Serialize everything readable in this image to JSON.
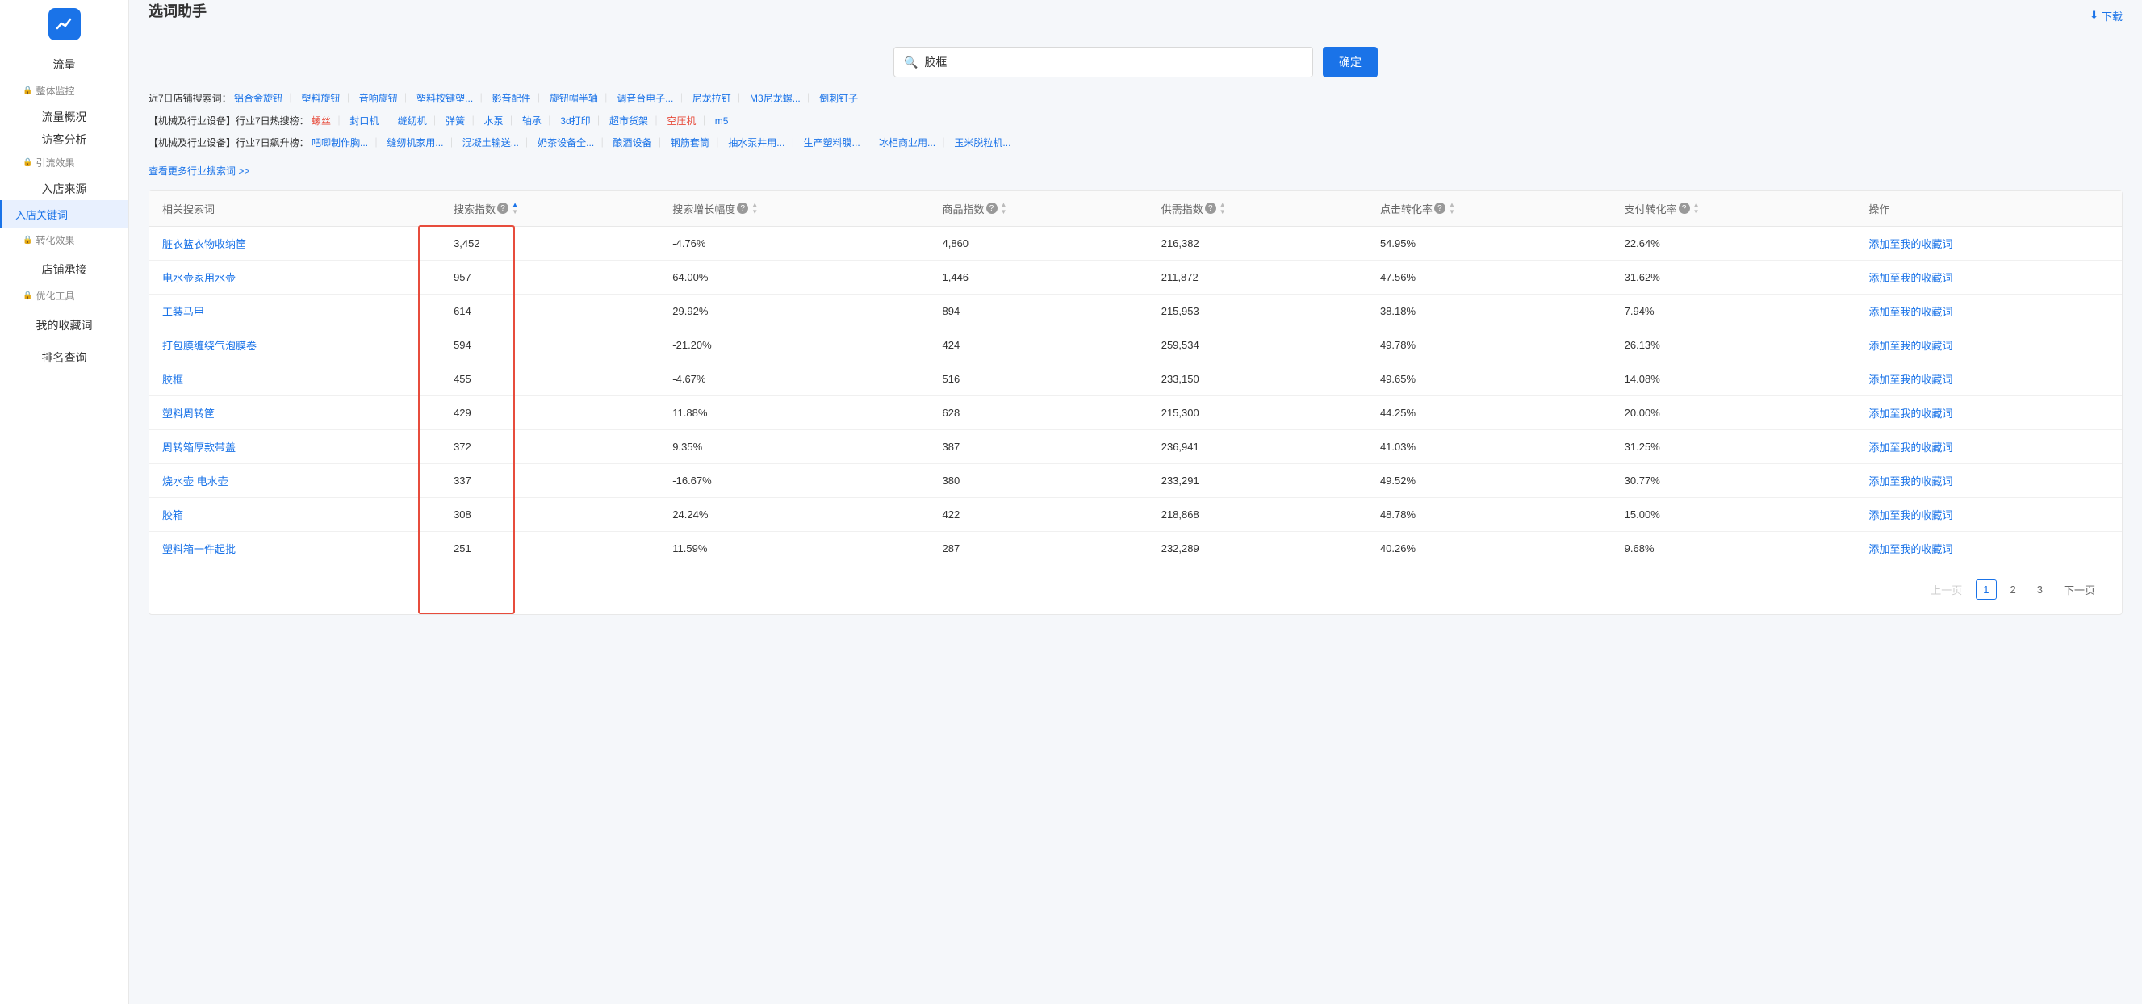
{
  "sidebar": {
    "logo_alt": "chart-icon",
    "sections": [
      {
        "title": "流量",
        "items": [
          {
            "label": "整体监控",
            "has_lock": true,
            "active": false,
            "id": "overall-monitor"
          },
          {
            "label": "流量概况",
            "has_lock": false,
            "active": false,
            "id": "traffic-overview"
          },
          {
            "label": "访客分析",
            "has_lock": false,
            "active": false,
            "id": "visitor-analysis"
          },
          {
            "label": "引流效果",
            "has_lock": true,
            "active": false,
            "id": "traffic-effect"
          },
          {
            "label": "入店来源",
            "has_lock": false,
            "active": false,
            "id": "store-source"
          },
          {
            "label": "入店关键词",
            "has_lock": false,
            "active": true,
            "id": "store-keywords"
          },
          {
            "label": "转化效果",
            "has_lock": true,
            "active": false,
            "id": "conversion-effect"
          }
        ]
      },
      {
        "title": "店铺承接",
        "items": []
      },
      {
        "title": "优化工具",
        "items": [],
        "has_lock": true
      },
      {
        "title": "我的收藏词",
        "items": []
      },
      {
        "title": "排名查询",
        "items": []
      }
    ]
  },
  "header": {
    "title": "选词助手",
    "download_label": "下载"
  },
  "search": {
    "placeholder": "胶框",
    "value": "胶框",
    "confirm_label": "确定"
  },
  "hot_search": {
    "label_7day": "近7日店铺搜索词：",
    "items_7day": [
      "铝合金旋钮",
      "塑料旋钮",
      "音响旋钮",
      "塑料按键塑...",
      "影音配件",
      "旋钮帽半轴",
      "调音台电子...",
      "尼龙拉钉",
      "M3尼龙螺...",
      "倒刺钉子"
    ],
    "label_industry_hot": "【机械及行业设备】行业7日热搜榜：",
    "items_industry_hot": [
      "螺丝",
      "封口机",
      "缝纫机",
      "弹簧",
      "水泵",
      "轴承",
      "3d打印",
      "超市货架",
      "空压机",
      "m5"
    ],
    "label_industry_up": "【机械及行业设备】行业7日飙升榜：",
    "items_industry_up": [
      "吧唧制作胸...",
      "缝纫机家用...",
      "混凝土输送...",
      "奶茶设备全...",
      "酿酒设备",
      "钢筋套筒",
      "抽水泵井用...",
      "生产塑料膜...",
      "冰柜商业用...",
      "玉米脱粒机..."
    ]
  },
  "more_link": "查看更多行业搜索词 >>",
  "table": {
    "columns": [
      {
        "id": "keyword",
        "label": "相关搜索词",
        "sortable": false,
        "info": false
      },
      {
        "id": "search_index",
        "label": "搜索指数",
        "sortable": true,
        "info": true,
        "active_sort": true
      },
      {
        "id": "search_growth",
        "label": "搜索增长幅度",
        "sortable": true,
        "info": true
      },
      {
        "id": "product_index",
        "label": "商品指数",
        "sortable": true,
        "info": true
      },
      {
        "id": "supply_index",
        "label": "供需指数",
        "sortable": true,
        "info": true
      },
      {
        "id": "click_conversion",
        "label": "点击转化率",
        "sortable": true,
        "info": true
      },
      {
        "id": "pay_conversion",
        "label": "支付转化率",
        "sortable": true,
        "info": true
      },
      {
        "id": "action",
        "label": "操作",
        "sortable": false,
        "info": false
      }
    ],
    "rows": [
      {
        "keyword": "脏衣篮衣物收纳筐",
        "search_index": "3,452",
        "search_growth": "-4.76%",
        "product_index": "4,860",
        "supply_index": "216,382",
        "click_conversion": "54.95%",
        "pay_conversion": "22.64%",
        "action": "添加至我的收藏词"
      },
      {
        "keyword": "电水壶家用水壶",
        "search_index": "957",
        "search_growth": "64.00%",
        "product_index": "1,446",
        "supply_index": "211,872",
        "click_conversion": "47.56%",
        "pay_conversion": "31.62%",
        "action": "添加至我的收藏词"
      },
      {
        "keyword": "工装马甲",
        "search_index": "614",
        "search_growth": "29.92%",
        "product_index": "894",
        "supply_index": "215,953",
        "click_conversion": "38.18%",
        "pay_conversion": "7.94%",
        "action": "添加至我的收藏词"
      },
      {
        "keyword": "打包膜缠绕气泡膜卷",
        "search_index": "594",
        "search_growth": "-21.20%",
        "product_index": "424",
        "supply_index": "259,534",
        "click_conversion": "49.78%",
        "pay_conversion": "26.13%",
        "action": "添加至我的收藏词"
      },
      {
        "keyword": "胶框",
        "search_index": "455",
        "search_growth": "-4.67%",
        "product_index": "516",
        "supply_index": "233,150",
        "click_conversion": "49.65%",
        "pay_conversion": "14.08%",
        "action": "添加至我的收藏词"
      },
      {
        "keyword": "塑料周转筐",
        "search_index": "429",
        "search_growth": "11.88%",
        "product_index": "628",
        "supply_index": "215,300",
        "click_conversion": "44.25%",
        "pay_conversion": "20.00%",
        "action": "添加至我的收藏词"
      },
      {
        "keyword": "周转箱厚款带盖",
        "search_index": "372",
        "search_growth": "9.35%",
        "product_index": "387",
        "supply_index": "236,941",
        "click_conversion": "41.03%",
        "pay_conversion": "31.25%",
        "action": "添加至我的收藏词"
      },
      {
        "keyword": "烧水壶 电水壶",
        "search_index": "337",
        "search_growth": "-16.67%",
        "product_index": "380",
        "supply_index": "233,291",
        "click_conversion": "49.52%",
        "pay_conversion": "30.77%",
        "action": "添加至我的收藏词"
      },
      {
        "keyword": "胶箱",
        "search_index": "308",
        "search_growth": "24.24%",
        "product_index": "422",
        "supply_index": "218,868",
        "click_conversion": "48.78%",
        "pay_conversion": "15.00%",
        "action": "添加至我的收藏词"
      },
      {
        "keyword": "塑料箱一件起批",
        "search_index": "251",
        "search_growth": "11.59%",
        "product_index": "287",
        "supply_index": "232,289",
        "click_conversion": "40.26%",
        "pay_conversion": "9.68%",
        "action": "添加至我的收藏词"
      }
    ]
  },
  "pagination": {
    "prev": "上一页",
    "next": "下一页",
    "pages": [
      "1",
      "2",
      "3"
    ],
    "current": "1"
  }
}
